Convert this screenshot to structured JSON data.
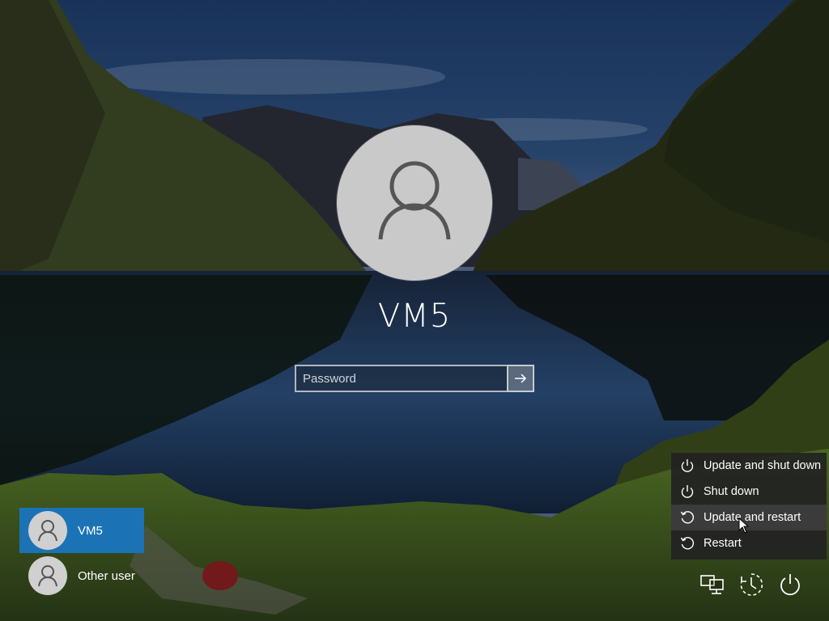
{
  "login": {
    "username": "VM5",
    "password_placeholder": "Password"
  },
  "users": [
    {
      "name": "VM5",
      "selected": true
    },
    {
      "name": "Other user",
      "selected": false
    }
  ],
  "power_menu": {
    "items": [
      {
        "label": "Update and shut down",
        "icon": "power-icon"
      },
      {
        "label": "Shut down",
        "icon": "power-icon"
      },
      {
        "label": "Update and restart",
        "icon": "restart-icon"
      },
      {
        "label": "Restart",
        "icon": "restart-icon"
      }
    ],
    "hovered_index": 2
  },
  "system_icons": [
    "network-icon",
    "ease-of-access-icon",
    "power-icon"
  ],
  "colors": {
    "selected_user": "#1b73b6",
    "menu_bg": "#222222"
  }
}
